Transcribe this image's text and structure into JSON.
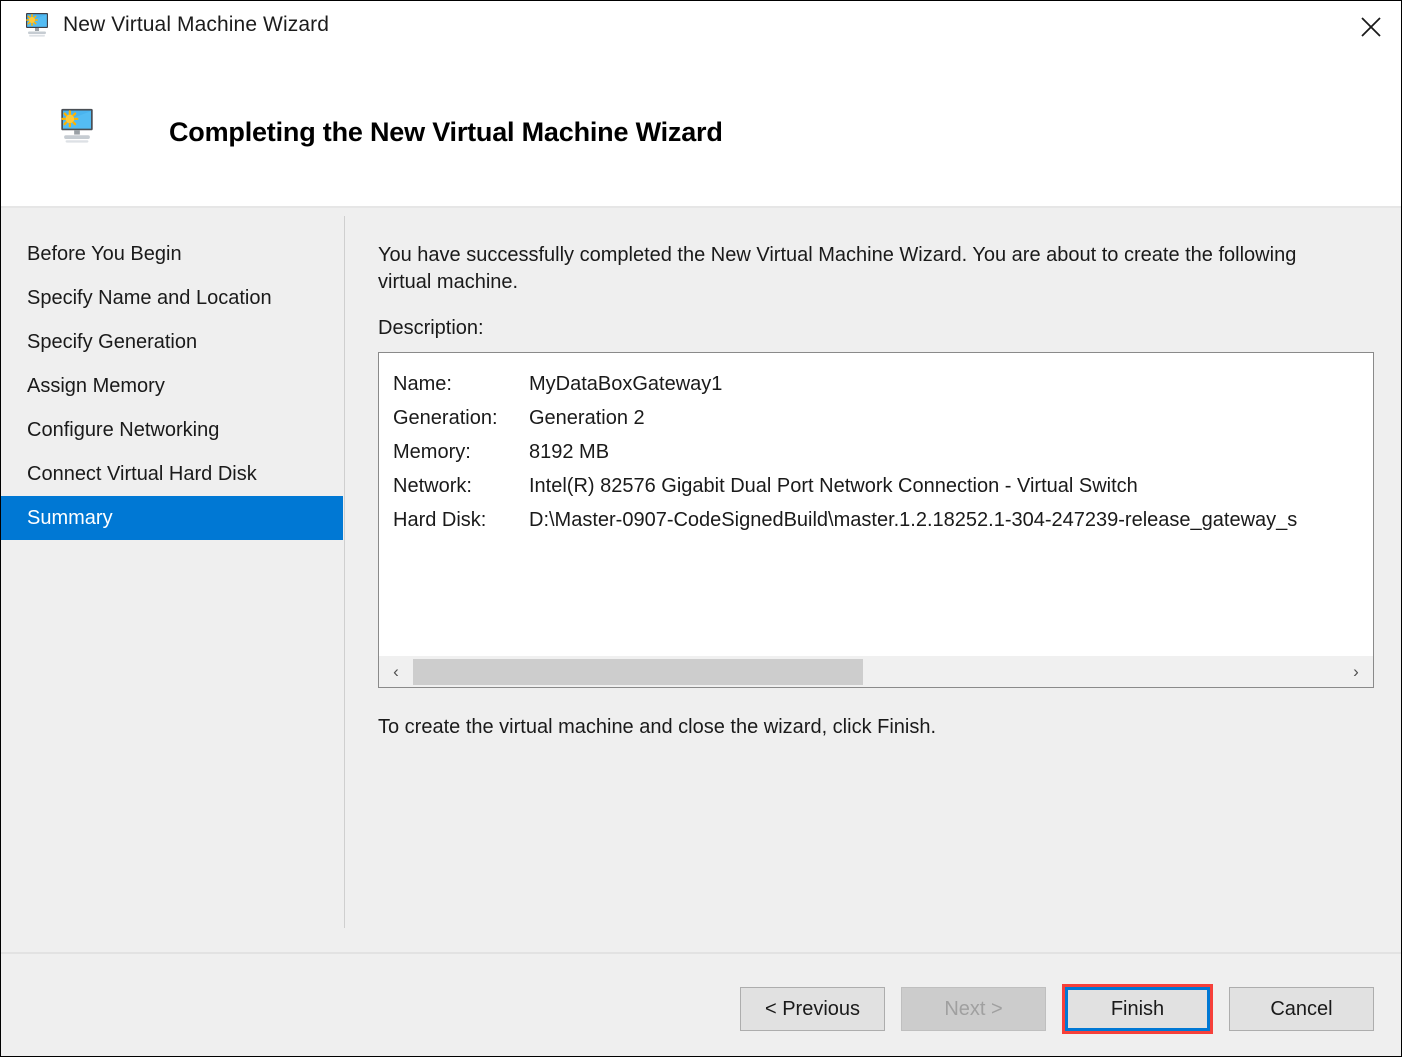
{
  "window": {
    "title": "New Virtual Machine Wizard",
    "icon": "virtual-machine-icon",
    "close_label": "✕"
  },
  "header": {
    "title": "Completing the New Virtual Machine Wizard",
    "icon": "virtual-machine-icon"
  },
  "sidebar": {
    "items": [
      {
        "label": "Before You Begin",
        "selected": false
      },
      {
        "label": "Specify Name and Location",
        "selected": false
      },
      {
        "label": "Specify Generation",
        "selected": false
      },
      {
        "label": "Assign Memory",
        "selected": false
      },
      {
        "label": "Configure Networking",
        "selected": false
      },
      {
        "label": "Connect Virtual Hard Disk",
        "selected": false
      },
      {
        "label": "Summary",
        "selected": true
      }
    ]
  },
  "main": {
    "intro": "You have successfully completed the New Virtual Machine Wizard. You are about to create the following virtual machine.",
    "description_label": "Description:",
    "summary_rows": [
      {
        "key": "Name:",
        "value": "MyDataBoxGateway1"
      },
      {
        "key": "Generation:",
        "value": "Generation 2"
      },
      {
        "key": "Memory:",
        "value": "8192 MB"
      },
      {
        "key": "Network:",
        "value": "Intel(R) 82576 Gigabit Dual Port Network Connection - Virtual Switch"
      },
      {
        "key": "Hard Disk:",
        "value": "D:\\Master-0907-CodeSignedBuild\\master.1.2.18252.1-304-247239-release_gateway_s"
      }
    ],
    "scrollbar": {
      "left_arrow": "‹",
      "right_arrow": "›"
    },
    "outro": "To create the virtual machine and close the wizard, click Finish."
  },
  "footer": {
    "buttons": [
      {
        "label": "< Previous",
        "state": "enabled"
      },
      {
        "label": "Next >",
        "state": "disabled"
      },
      {
        "label": "Finish",
        "state": "focused"
      },
      {
        "label": "Cancel",
        "state": "enabled"
      }
    ]
  },
  "colors": {
    "accent": "#0078d4",
    "annotation": "#f6403a",
    "body_bg": "#efefef",
    "header_bg": "#ffffff"
  }
}
